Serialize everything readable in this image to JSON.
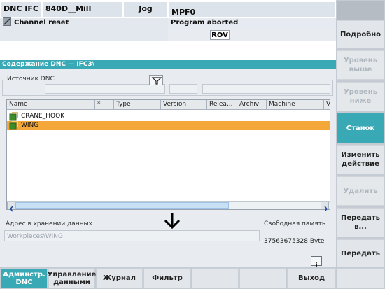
{
  "header": {
    "channel": "DNC IFC",
    "machine": "840D__Mill",
    "mode": "Jog",
    "program": "MPF0",
    "channel_status": "Channel reset",
    "program_status": "Program aborted",
    "rov": "ROV"
  },
  "panel": {
    "title": "Содержание DNC — IFC3\\",
    "source_label": "Источник DNC",
    "columns": [
      "Name",
      "*",
      "Type",
      "Version",
      "Relea...",
      "Archiv",
      "Machine",
      "V"
    ],
    "rows": [
      {
        "name": "CRANE_HOOK",
        "selected": false
      },
      {
        "name": "WING",
        "selected": true
      }
    ],
    "storage_label": "Адрес в хранении данных",
    "storage_value": "Workpieces\\WING",
    "free_memory_label": "Свободная память",
    "free_memory_value": "37563675328 Byte",
    "info_glyph": "i"
  },
  "softkeys_right": [
    {
      "label": "Подробно",
      "state": "normal"
    },
    {
      "label": "Уровень выше",
      "state": "disabled"
    },
    {
      "label": "Уровень ниже",
      "state": "disabled"
    },
    {
      "label": "Станок",
      "state": "active"
    },
    {
      "label": "Изменить действие",
      "state": "normal"
    },
    {
      "label": "Удалить",
      "state": "disabled"
    },
    {
      "label": "Передать в...",
      "state": "normal"
    },
    {
      "label": "Передать",
      "state": "normal"
    }
  ],
  "softkeys_bottom": [
    {
      "label": "Админстр. DNC",
      "state": "active"
    },
    {
      "label": "Управление данными",
      "state": "normal"
    },
    {
      "label": "Журнал",
      "state": "normal"
    },
    {
      "label": "Фильтр",
      "state": "normal"
    },
    {
      "label": "",
      "state": "normal"
    },
    {
      "label": "",
      "state": "normal"
    },
    {
      "label": "Выход",
      "state": "normal"
    },
    {
      "label": "",
      "state": "normal"
    }
  ],
  "colors": {
    "accent": "#3aa9b6",
    "selection": "#f4a83a",
    "header_bg": "#dde3ea"
  },
  "icons": {
    "filter": "filter-icon",
    "file": "workpiece-icon",
    "arrow": "arrow-down-icon",
    "channel": "channel-state-icon"
  }
}
